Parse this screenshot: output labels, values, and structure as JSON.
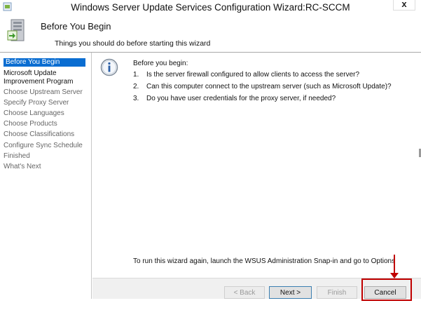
{
  "window": {
    "title": "Windows Server Update Services Configuration Wizard:RC-SCCM",
    "close_glyph": "x"
  },
  "header": {
    "title": "Before You Begin",
    "subtitle": "Things you should do before starting this wizard"
  },
  "nav": {
    "items": [
      {
        "label": "Before You Begin"
      },
      {
        "label": "Microsoft Update"
      },
      {
        "label": "Improvement Program"
      },
      {
        "label": "Choose Upstream Server"
      },
      {
        "label": "Specify Proxy Server"
      },
      {
        "label": "Choose Languages"
      },
      {
        "label": "Choose Products"
      },
      {
        "label": "Choose Classifications"
      },
      {
        "label": "Configure Sync Schedule"
      },
      {
        "label": "Finished"
      },
      {
        "label": "What's Next"
      }
    ]
  },
  "content": {
    "intro": "Before you begin:",
    "steps": [
      {
        "num": "1.",
        "text": "Is the server firewall configured to allow clients to access the server?"
      },
      {
        "num": "2.",
        "text": "Can this computer connect to the upstream server (such as Microsoft Update)?"
      },
      {
        "num": "3.",
        "text": "Do you have user credentials for the proxy server, if needed?"
      }
    ],
    "footer_note": "To run this wizard again, launch the WSUS Administration Snap-in and go to Options"
  },
  "buttons": {
    "back": "< Back",
    "next": "Next >",
    "finish": "Finish",
    "cancel": "Cancel"
  },
  "colors": {
    "selected_nav": "#0a6dd1",
    "highlight": "#c00000"
  },
  "icons": {
    "title": "server-wizard-icon",
    "header": "server-setup-icon",
    "info": "info-icon"
  }
}
